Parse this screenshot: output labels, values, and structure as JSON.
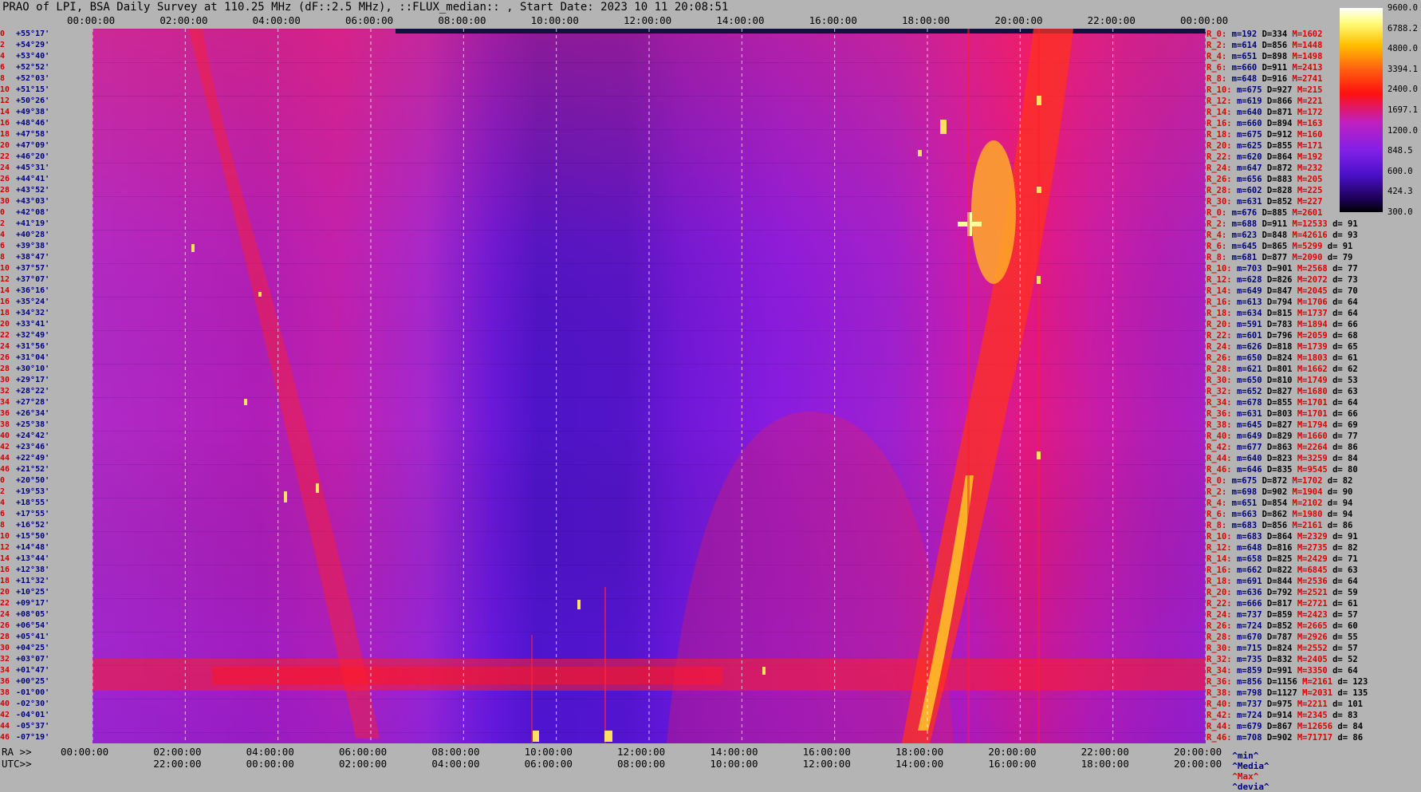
{
  "chart_data": {
    "type": "heatmap",
    "title": "PRAO of LPI, BSA Daily Survey at 110.25 MHz (dF::2.5 MHz), ::FLUX_median:: , Start Date: 2023 10 11 20:08:51",
    "top_ticks": [
      "00:00:00",
      "02:00:00",
      "04:00:00",
      "06:00:00",
      "08:00:00",
      "10:00:00",
      "12:00:00",
      "14:00:00",
      "16:00:00",
      "18:00:00",
      "20:00:00",
      "22:00:00",
      "00:00:00"
    ],
    "ra_ticks": [
      "00:00:00",
      "02:00:00",
      "04:00:00",
      "06:00:00",
      "08:00:00",
      "10:00:00",
      "12:00:00",
      "14:00:00",
      "16:00:00",
      "18:00:00",
      "20:00:00",
      "22:00:00",
      "20:00:00"
    ],
    "utc_ticks": [
      "22:00:00",
      "00:00:00",
      "02:00:00",
      "04:00:00",
      "06:00:00",
      "08:00:00",
      "10:00:00",
      "12:00:00",
      "14:00:00",
      "16:00:00",
      "18:00:00",
      "20:00:00"
    ],
    "ra_label": "RA >>",
    "utc_label": "UTC>>",
    "colorbar_ticks": [
      "9600.0",
      "6788.2",
      "4800.0",
      "3394.1",
      "2400.0",
      "1697.1",
      "1200.0",
      "848.5",
      "600.0",
      "424.3",
      "300.0"
    ],
    "footer": {
      "min": "^min^",
      "median": "^Media^",
      "max": "^Max^",
      "dev": "^devia^"
    },
    "declinations": [
      "+55°17'",
      "+54°29'",
      "+53°40'",
      "+52°52'",
      "+52°03'",
      "+51°15'",
      "+50°26'",
      "+49°38'",
      "+48°46'",
      "+47°58'",
      "+47°09'",
      "+46°20'",
      "+45°31'",
      "+44°41'",
      "+43°52'",
      "+43°03'",
      "+42°08'",
      "+41°19'",
      "+40°28'",
      "+39°38'",
      "+38°47'",
      "+37°57'",
      "+37°07'",
      "+36°16'",
      "+35°24'",
      "+34°32'",
      "+33°41'",
      "+32°49'",
      "+31°56'",
      "+31°04'",
      "+30°10'",
      "+29°17'",
      "+28°22'",
      "+27°28'",
      "+26°34'",
      "+25°38'",
      "+24°42'",
      "+23°46'",
      "+22°49'",
      "+21°52'",
      "+20°50'",
      "+19°53'",
      "+18°55'",
      "+17°55'",
      "+16°52'",
      "+15°50'",
      "+14°48'",
      "+13°44'",
      "+12°38'",
      "+11°32'",
      "+10°25'",
      "+09°17'",
      "+08°05'",
      "+06°54'",
      "+05°41'",
      "+04°25'",
      "+03°07'",
      "+01°47'",
      "+00°25'",
      "-01°00'",
      "-02°30'",
      "-04°01'",
      "-05°37'",
      "-07°19'"
    ],
    "dec_indices": [
      "0",
      "2",
      "4",
      "6",
      "8",
      "10",
      "12",
      "14",
      "16",
      "18",
      "20",
      "22",
      "24",
      "26",
      "28",
      "30",
      "0",
      "2",
      "4",
      "6",
      "8",
      "10",
      "12",
      "14",
      "16",
      "18",
      "20",
      "22",
      "24",
      "26",
      "28",
      "30",
      "32",
      "34",
      "36",
      "38",
      "40",
      "42",
      "44",
      "46",
      "0",
      "2",
      "4",
      "6",
      "8",
      "10",
      "12",
      "14",
      "16",
      "18",
      "20",
      "22",
      "24",
      "26",
      "28",
      "30",
      "32",
      "34",
      "36",
      "38",
      "40",
      "42",
      "44",
      "46"
    ],
    "beam_stats": [
      {
        "beam": "R_0:",
        "min": "m=192",
        "med": "D=334",
        "max": "M=1602",
        "dev": ""
      },
      {
        "beam": "R_2:",
        "min": "m=614",
        "med": "D=856",
        "max": "M=1448",
        "dev": ""
      },
      {
        "beam": "R_4:",
        "min": "m=651",
        "med": "D=898",
        "max": "M=1498",
        "dev": ""
      },
      {
        "beam": "R_6:",
        "min": "m=660",
        "med": "D=911",
        "max": "M=2413",
        "dev": ""
      },
      {
        "beam": "R_8:",
        "min": "m=648",
        "med": "D=916",
        "max": "M=2741",
        "dev": ""
      },
      {
        "beam": "R_10:",
        "min": "m=675",
        "med": "D=927",
        "max": "M=215",
        "dev": ""
      },
      {
        "beam": "R_12:",
        "min": "m=619",
        "med": "D=866",
        "max": "M=221",
        "dev": ""
      },
      {
        "beam": "R_14:",
        "min": "m=640",
        "med": "D=871",
        "max": "M=172",
        "dev": ""
      },
      {
        "beam": "R_16:",
        "min": "m=660",
        "med": "D=894",
        "max": "M=163",
        "dev": ""
      },
      {
        "beam": "R_18:",
        "min": "m=675",
        "med": "D=912",
        "max": "M=160",
        "dev": ""
      },
      {
        "beam": "R_20:",
        "min": "m=625",
        "med": "D=855",
        "max": "M=171",
        "dev": ""
      },
      {
        "beam": "R_22:",
        "min": "m=620",
        "med": "D=864",
        "max": "M=192",
        "dev": ""
      },
      {
        "beam": "R_24:",
        "min": "m=647",
        "med": "D=872",
        "max": "M=232",
        "dev": ""
      },
      {
        "beam": "R_26:",
        "min": "m=656",
        "med": "D=883",
        "max": "M=205",
        "dev": ""
      },
      {
        "beam": "R_28:",
        "min": "m=602",
        "med": "D=828",
        "max": "M=225",
        "dev": ""
      },
      {
        "beam": "R_30:",
        "min": "m=631",
        "med": "D=852",
        "max": "M=227",
        "dev": ""
      },
      {
        "beam": "R_0:",
        "min": "m=676",
        "med": "D=885",
        "max": "M=2601",
        "dev": ""
      },
      {
        "beam": "R_2:",
        "min": "m=688",
        "med": "D=911",
        "max": "M=12533",
        "dev": "d= 91"
      },
      {
        "beam": "R_4:",
        "min": "m=623",
        "med": "D=848",
        "max": "M=42616",
        "dev": "d= 93"
      },
      {
        "beam": "R_6:",
        "min": "m=645",
        "med": "D=865",
        "max": "M=5299",
        "dev": "d= 91"
      },
      {
        "beam": "R_8:",
        "min": "m=681",
        "med": "D=877",
        "max": "M=2090",
        "dev": "d= 79"
      },
      {
        "beam": "R_10:",
        "min": "m=703",
        "med": "D=901",
        "max": "M=2568",
        "dev": "d= 77"
      },
      {
        "beam": "R_12:",
        "min": "m=628",
        "med": "D=826",
        "max": "M=2072",
        "dev": "d= 73"
      },
      {
        "beam": "R_14:",
        "min": "m=649",
        "med": "D=847",
        "max": "M=2045",
        "dev": "d= 70"
      },
      {
        "beam": "R_16:",
        "min": "m=613",
        "med": "D=794",
        "max": "M=1706",
        "dev": "d= 64"
      },
      {
        "beam": "R_18:",
        "min": "m=634",
        "med": "D=815",
        "max": "M=1737",
        "dev": "d= 64"
      },
      {
        "beam": "R_20:",
        "min": "m=591",
        "med": "D=783",
        "max": "M=1894",
        "dev": "d= 66"
      },
      {
        "beam": "R_22:",
        "min": "m=601",
        "med": "D=796",
        "max": "M=2059",
        "dev": "d= 68"
      },
      {
        "beam": "R_24:",
        "min": "m=626",
        "med": "D=818",
        "max": "M=1739",
        "dev": "d= 65"
      },
      {
        "beam": "R_26:",
        "min": "m=650",
        "med": "D=824",
        "max": "M=1803",
        "dev": "d= 61"
      },
      {
        "beam": "R_28:",
        "min": "m=621",
        "med": "D=801",
        "max": "M=1662",
        "dev": "d= 62"
      },
      {
        "beam": "R_30:",
        "min": "m=650",
        "med": "D=810",
        "max": "M=1749",
        "dev": "d= 53"
      },
      {
        "beam": "R_32:",
        "min": "m=652",
        "med": "D=827",
        "max": "M=1680",
        "dev": "d= 63"
      },
      {
        "beam": "R_34:",
        "min": "m=678",
        "med": "D=855",
        "max": "M=1701",
        "dev": "d= 64"
      },
      {
        "beam": "R_36:",
        "min": "m=631",
        "med": "D=803",
        "max": "M=1701",
        "dev": "d= 66"
      },
      {
        "beam": "R_38:",
        "min": "m=645",
        "med": "D=827",
        "max": "M=1794",
        "dev": "d= 69"
      },
      {
        "beam": "R_40:",
        "min": "m=649",
        "med": "D=829",
        "max": "M=1660",
        "dev": "d= 77"
      },
      {
        "beam": "R_42:",
        "min": "m=677",
        "med": "D=863",
        "max": "M=2264",
        "dev": "d= 86"
      },
      {
        "beam": "R_44:",
        "min": "m=640",
        "med": "D=823",
        "max": "M=3259",
        "dev": "d= 84"
      },
      {
        "beam": "R_46:",
        "min": "m=646",
        "med": "D=835",
        "max": "M=9545",
        "dev": "d= 80"
      },
      {
        "beam": "R_0:",
        "min": "m=675",
        "med": "D=872",
        "max": "M=1702",
        "dev": "d= 82"
      },
      {
        "beam": "R_2:",
        "min": "m=698",
        "med": "D=902",
        "max": "M=1904",
        "dev": "d= 90"
      },
      {
        "beam": "R_4:",
        "min": "m=651",
        "med": "D=854",
        "max": "M=2102",
        "dev": "d= 94"
      },
      {
        "beam": "R_6:",
        "min": "m=663",
        "med": "D=862",
        "max": "M=1980",
        "dev": "d= 94"
      },
      {
        "beam": "R_8:",
        "min": "m=683",
        "med": "D=856",
        "max": "M=2161",
        "dev": "d= 86"
      },
      {
        "beam": "R_10:",
        "min": "m=683",
        "med": "D=864",
        "max": "M=2329",
        "dev": "d= 91"
      },
      {
        "beam": "R_12:",
        "min": "m=648",
        "med": "D=816",
        "max": "M=2735",
        "dev": "d= 82"
      },
      {
        "beam": "R_14:",
        "min": "m=658",
        "med": "D=825",
        "max": "M=2429",
        "dev": "d= 71"
      },
      {
        "beam": "R_16:",
        "min": "m=662",
        "med": "D=822",
        "max": "M=6845",
        "dev": "d= 63"
      },
      {
        "beam": "R_18:",
        "min": "m=691",
        "med": "D=844",
        "max": "M=2536",
        "dev": "d= 64"
      },
      {
        "beam": "R_20:",
        "min": "m=636",
        "med": "D=792",
        "max": "M=2521",
        "dev": "d= 59"
      },
      {
        "beam": "R_22:",
        "min": "m=666",
        "med": "D=817",
        "max": "M=2721",
        "dev": "d= 61"
      },
      {
        "beam": "R_24:",
        "min": "m=737",
        "med": "D=859",
        "max": "M=2423",
        "dev": "d= 57"
      },
      {
        "beam": "R_26:",
        "min": "m=724",
        "med": "D=852",
        "max": "M=2665",
        "dev": "d= 60"
      },
      {
        "beam": "R_28:",
        "min": "m=670",
        "med": "D=787",
        "max": "M=2926",
        "dev": "d= 55"
      },
      {
        "beam": "R_30:",
        "min": "m=715",
        "med": "D=824",
        "max": "M=2552",
        "dev": "d= 57"
      },
      {
        "beam": "R_32:",
        "min": "m=735",
        "med": "D=832",
        "max": "M=2405",
        "dev": "d= 52"
      },
      {
        "beam": "R_34:",
        "min": "m=859",
        "med": "D=991",
        "max": "M=3350",
        "dev": "d= 64"
      },
      {
        "beam": "R_36:",
        "min": "m=856",
        "med": "D=1156",
        "max": "M=2161",
        "dev": "d= 123"
      },
      {
        "beam": "R_38:",
        "min": "m=798",
        "med": "D=1127",
        "max": "M=2031",
        "dev": "d= 135"
      },
      {
        "beam": "R_40:",
        "min": "m=737",
        "med": "D=975",
        "max": "M=2211",
        "dev": "d= 101"
      },
      {
        "beam": "R_42:",
        "min": "m=724",
        "med": "D=914",
        "max": "M=2345",
        "dev": "d= 83"
      },
      {
        "beam": "R_44:",
        "min": "m=679",
        "med": "D=867",
        "max": "M=12656",
        "dev": "d= 84"
      },
      {
        "beam": "R_46:",
        "min": "m=708",
        "med": "D=902",
        "max": "M=71717",
        "dev": "d= 86"
      }
    ],
    "colors": {
      "background": "#b4b4b4",
      "low": "#7a18d8",
      "mid": "#d020b0",
      "high": "#ff1010",
      "peak": "#ffff80"
    }
  }
}
